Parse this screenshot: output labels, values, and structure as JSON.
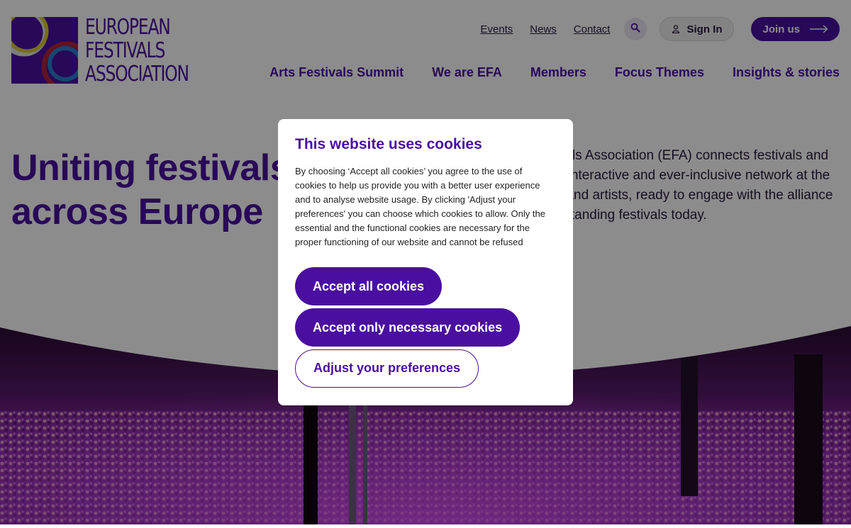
{
  "header": {
    "logo": {
      "lines": [
        "EUROPEAN",
        "FESTIVALS",
        "ASSOCIATION"
      ]
    },
    "utility_links": [
      "Events",
      "News",
      "Contact"
    ],
    "search_icon": "search-icon",
    "sign_in_label": "Sign In",
    "join_label": "Join us",
    "nav": [
      "Arts Festivals Summit",
      "We are EFA",
      "Members",
      "Focus Themes",
      "Insights & stories"
    ]
  },
  "hero": {
    "title_line1": "Uniting festivals",
    "title_line2": "across Europe",
    "description": "The European Festivals Association (EFA) connects festivals and cultural leaders in an interactive and ever-inclusive network at the service of audiences and artists, ready to engage with the alliance of more than 100 outstanding festivals today."
  },
  "cookie_modal": {
    "title": "This website uses cookies",
    "text": "By choosing ‘Accept all cookies’ you agree to the use of cookies to help us provide you with a better user experience and to analyse website usage. By clicking 'Adjust your preferences' you can choose which cookies to allow. Only the essential and the functional cookies are necessary for the proper functioning of our website and cannot be refused",
    "accept_all": "Accept all cookies",
    "accept_necessary": "Accept only necessary cookies",
    "adjust": "Adjust your preferences"
  },
  "colors": {
    "brand_purple": "#4a0fa0",
    "overlay": "rgba(0,0,0,0.45)"
  }
}
